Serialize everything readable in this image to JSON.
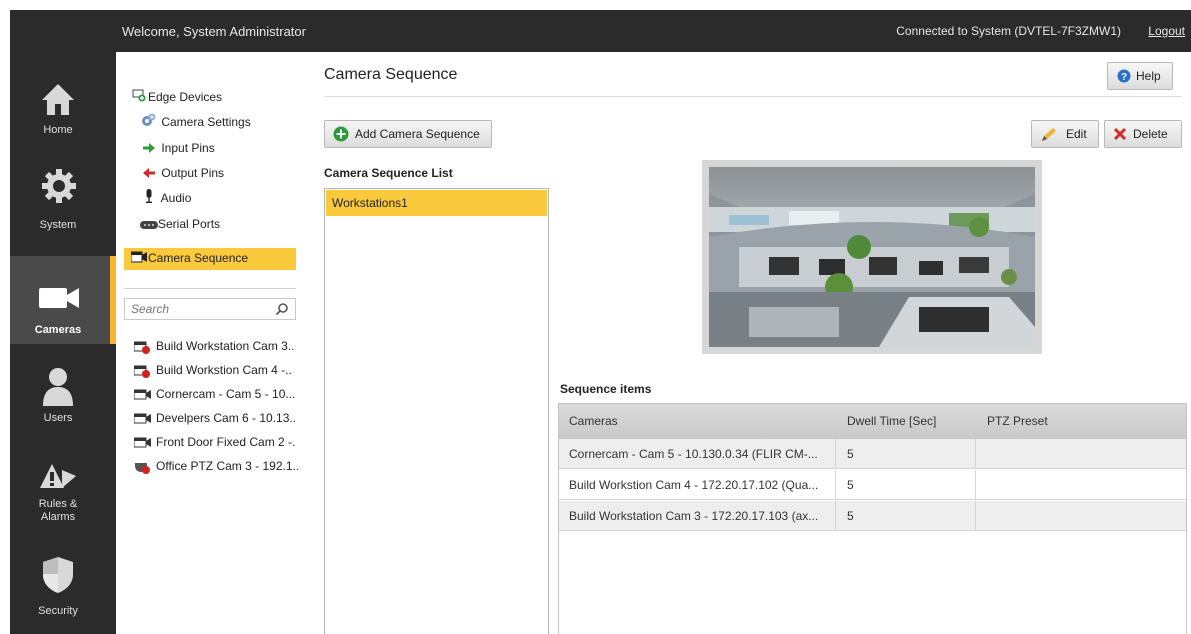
{
  "topbar": {
    "welcome": "Welcome, System Administrator",
    "connection": "Connected to System (DVTEL-7F3ZMW1)",
    "logout": "Logout"
  },
  "nav": {
    "items": [
      {
        "label": "Home",
        "icon": "home-icon"
      },
      {
        "label": "System",
        "icon": "gear-icon"
      },
      {
        "label": "Cameras",
        "icon": "camera-icon",
        "active": true
      },
      {
        "label": "Users",
        "icon": "user-icon"
      },
      {
        "label": "Rules &\nAlarms",
        "icon": "alarm-icon"
      },
      {
        "label": "Security",
        "icon": "shield-icon"
      }
    ]
  },
  "tree": {
    "items": [
      {
        "label": "Edge Devices",
        "icon": "edge-devices-icon"
      },
      {
        "label": "Camera Settings",
        "icon": "camera-settings-icon"
      },
      {
        "label": "Input Pins",
        "icon": "arrow-right-icon"
      },
      {
        "label": "Output Pins",
        "icon": "arrow-left-icon"
      },
      {
        "label": "Audio",
        "icon": "microphone-icon"
      },
      {
        "label": "Serial Ports",
        "icon": "serial-port-icon"
      },
      {
        "label": "Camera Sequence",
        "icon": "camera-sequence-icon",
        "selected": true
      }
    ]
  },
  "search": {
    "placeholder": "Search"
  },
  "cameras": [
    "Build Workstation Cam 3..",
    "Build Workstion Cam 4 -..",
    "Cornercam - Cam 5 - 10...",
    "Develpers Cam 6 - 10.13..",
    "Front Door Fixed Cam 2 -.",
    "Office PTZ Cam 3 - 192.1.."
  ],
  "main": {
    "title": "Camera Sequence",
    "help": "Help",
    "add_button": "Add Camera Sequence",
    "edit_button": "Edit",
    "delete_button": "Delete",
    "list_title": "Camera Sequence List",
    "list_items": [
      "Workstations1"
    ],
    "items_title": "Sequence items",
    "table": {
      "headers": [
        "Cameras",
        "Dwell Time [Sec]",
        "PTZ Preset"
      ],
      "rows": [
        [
          "Cornercam - Cam 5 - 10.130.0.34 (FLIR CM-...",
          "5",
          ""
        ],
        [
          "Build Workstion Cam 4 - 172.20.17.102 (Qua...",
          "5",
          ""
        ],
        [
          "Build Workstation Cam 3 - 172.20.17.103 (ax...",
          "5",
          ""
        ]
      ]
    }
  },
  "colors": {
    "accent": "#fbc93c",
    "nav_bg": "#2b2b2b",
    "nav_active": "#4a4a4a"
  }
}
